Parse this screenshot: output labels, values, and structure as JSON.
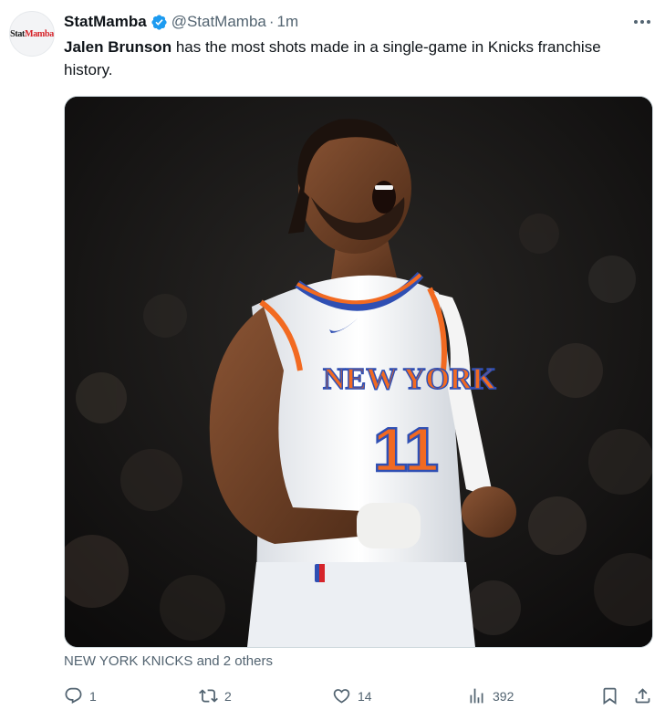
{
  "author": {
    "avatar_text_1": "Stat",
    "avatar_text_2": "Mamba",
    "display_name": "StatMamba",
    "handle": "@StatMamba",
    "separator": "·",
    "time": "1m"
  },
  "tweet": {
    "mention": "Jalen Brunson",
    "text": " has the most shots made in a single-game in Knicks franchise history."
  },
  "photo": {
    "jersey_text": "NEW YORK",
    "jersey_number": "11"
  },
  "tags": "NEW YORK KNICKS and 2 others",
  "actions": {
    "replies": "1",
    "reposts": "2",
    "likes": "14",
    "views": "392"
  },
  "colors": {
    "verified": "#1d9bf0",
    "muted": "#536471",
    "knicks_orange": "#f26a21",
    "knicks_blue": "#2f4fb3"
  }
}
